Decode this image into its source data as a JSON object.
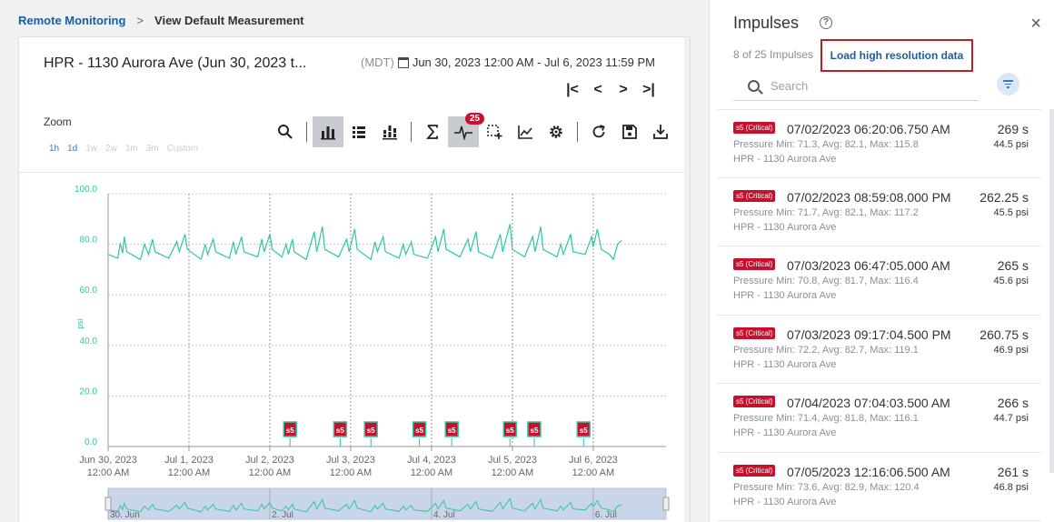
{
  "breadcrumb": {
    "root": "Remote Monitoring",
    "sep": ">",
    "current": "View Default Measurement"
  },
  "card": {
    "title": "HPR - 1130 Aurora Ave (Jun 30, 2023 t...",
    "tz": "(MDT)",
    "range": "Jun 30, 2023 12:00 AM - Jul 6, 2023 11:59 PM",
    "pager": [
      "|<",
      "<",
      ">",
      ">|"
    ]
  },
  "zoom": {
    "label": "Zoom",
    "options": [
      "1h",
      "1d",
      "1w",
      "2w",
      "1m",
      "3m",
      "Custom"
    ],
    "active": [
      "1h",
      "1d"
    ]
  },
  "toolbar": {
    "impulse_badge": "25"
  },
  "chart_data": {
    "type": "line",
    "ylabel": "psi",
    "ylim": [
      0,
      100
    ],
    "yticks": [
      "100.0",
      "80.0",
      "60.0",
      "40.0",
      "20.0",
      "0.0"
    ],
    "xticks": [
      [
        "Jun 30, 2023",
        "12:00 AM"
      ],
      [
        "Jul 1, 2023",
        "12:00 AM"
      ],
      [
        "Jul 2, 2023",
        "12:00 AM"
      ],
      [
        "Jul 3, 2023",
        "12:00 AM"
      ],
      [
        "Jul 4, 2023",
        "12:00 AM"
      ],
      [
        "Jul 5, 2023",
        "12:00 AM"
      ],
      [
        "Jul 6, 2023",
        "12:00 AM"
      ]
    ],
    "xlim_days": [
      0,
      6.9
    ],
    "series": [
      {
        "color": "#2ec7a0",
        "points": [
          [
            0.0,
            76.0
          ],
          [
            0.12,
            74.5
          ],
          [
            0.15,
            80.5
          ],
          [
            0.18,
            76.5
          ],
          [
            0.2,
            83.0
          ],
          [
            0.23,
            77.0
          ],
          [
            0.4,
            74.0
          ],
          [
            0.45,
            80.0
          ],
          [
            0.5,
            76.0
          ],
          [
            0.55,
            82.0
          ],
          [
            0.58,
            77.0
          ],
          [
            0.75,
            74.5
          ],
          [
            0.85,
            81.0
          ],
          [
            0.88,
            77.0
          ],
          [
            0.95,
            84.0
          ],
          [
            0.98,
            78.0
          ],
          [
            1.15,
            74.0
          ],
          [
            1.2,
            80.0
          ],
          [
            1.23,
            76.0
          ],
          [
            1.3,
            82.0
          ],
          [
            1.33,
            77.0
          ],
          [
            1.5,
            74.5
          ],
          [
            1.55,
            81.0
          ],
          [
            1.58,
            76.0
          ],
          [
            1.65,
            83.0
          ],
          [
            1.68,
            77.0
          ],
          [
            1.85,
            75.0
          ],
          [
            1.9,
            82.0
          ],
          [
            1.93,
            77.0
          ],
          [
            2.0,
            84.0
          ],
          [
            2.03,
            78.0
          ],
          [
            2.15,
            75.0
          ],
          [
            2.2,
            80.0
          ],
          [
            2.23,
            76.0
          ],
          [
            2.28,
            82.0
          ],
          [
            2.3,
            77.0
          ],
          [
            2.45,
            74.0
          ],
          [
            2.55,
            85.0
          ],
          [
            2.58,
            77.0
          ],
          [
            2.65,
            87.0
          ],
          [
            2.68,
            78.0
          ],
          [
            2.85,
            75.0
          ],
          [
            2.95,
            82.0
          ],
          [
            2.98,
            77.0
          ],
          [
            3.05,
            86.0
          ],
          [
            3.08,
            78.0
          ],
          [
            3.25,
            74.0
          ],
          [
            3.3,
            81.0
          ],
          [
            3.33,
            77.0
          ],
          [
            3.4,
            83.0
          ],
          [
            3.43,
            77.0
          ],
          [
            3.6,
            74.5
          ],
          [
            3.65,
            80.0
          ],
          [
            3.68,
            76.0
          ],
          [
            3.75,
            81.0
          ],
          [
            3.78,
            76.0
          ],
          [
            3.95,
            74.5
          ],
          [
            4.05,
            83.0
          ],
          [
            4.08,
            77.0
          ],
          [
            4.15,
            86.0
          ],
          [
            4.18,
            78.0
          ],
          [
            4.35,
            75.0
          ],
          [
            4.45,
            82.0
          ],
          [
            4.48,
            77.0
          ],
          [
            4.55,
            85.0
          ],
          [
            4.58,
            77.0
          ],
          [
            4.75,
            74.5
          ],
          [
            4.85,
            84.0
          ],
          [
            4.88,
            77.0
          ],
          [
            4.97,
            88.0
          ],
          [
            5.0,
            78.0
          ],
          [
            5.15,
            75.0
          ],
          [
            5.25,
            83.0
          ],
          [
            5.28,
            77.0
          ],
          [
            5.35,
            87.0
          ],
          [
            5.38,
            78.0
          ],
          [
            5.55,
            75.0
          ],
          [
            5.6,
            80.0
          ],
          [
            5.63,
            76.0
          ],
          [
            5.72,
            84.0
          ],
          [
            5.75,
            77.0
          ],
          [
            5.9,
            76.0
          ],
          [
            5.98,
            83.0
          ],
          [
            6.0,
            79.0
          ],
          [
            6.05,
            86.0
          ],
          [
            6.1,
            78.0
          ],
          [
            6.2,
            76.0
          ],
          [
            6.25,
            74.0
          ],
          [
            6.3,
            80.0
          ],
          [
            6.35,
            81.5
          ]
        ]
      }
    ],
    "markers": {
      "label": "s5",
      "x_days": [
        2.25,
        2.87,
        3.25,
        3.85,
        4.25,
        4.97,
        5.27,
        5.88
      ]
    },
    "navigator_labels": [
      "30. Jun",
      "2. Jul",
      "4. Jul",
      "6. Jul"
    ]
  },
  "panel": {
    "title": "Impulses",
    "help": "?",
    "close": "×",
    "count": "8 of 25 Impulses",
    "load_label": "Load high resolution data",
    "search_placeholder": "Search",
    "items": [
      {
        "tag": "s5 (Critical)",
        "ts": "07/02/2023 06:20:06.750 AM",
        "dur": "269 s",
        "stats": "Pressure Min: 71.3, Avg: 82.1, Max: 115.8",
        "psi": "44.5 psi",
        "loc": "HPR - 1130 Aurora Ave"
      },
      {
        "tag": "s5 (Critical)",
        "ts": "07/02/2023 08:59:08.000 PM",
        "dur": "262.25 s",
        "stats": "Pressure Min: 71.7, Avg: 82.1, Max: 117.2",
        "psi": "45.5 psi",
        "loc": "HPR - 1130 Aurora Ave"
      },
      {
        "tag": "s5 (Critical)",
        "ts": "07/03/2023 06:47:05.000 AM",
        "dur": "265 s",
        "stats": "Pressure Min: 70.8, Avg: 81.7, Max: 116.4",
        "psi": "45.6 psi",
        "loc": "HPR - 1130 Aurora Ave"
      },
      {
        "tag": "s5 (Critical)",
        "ts": "07/03/2023 09:17:04.500 PM",
        "dur": "260.75 s",
        "stats": "Pressure Min: 72.2, Avg: 82.7, Max: 119.1",
        "psi": "46.9 psi",
        "loc": "HPR - 1130 Aurora Ave"
      },
      {
        "tag": "s5 (Critical)",
        "ts": "07/04/2023 07:04:03.500 AM",
        "dur": "266 s",
        "stats": "Pressure Min: 71.4, Avg: 81.8, Max: 116.1",
        "psi": "44.7 psi",
        "loc": "HPR - 1130 Aurora Ave"
      },
      {
        "tag": "s5 (Critical)",
        "ts": "07/05/2023 12:16:06.500 AM",
        "dur": "261 s",
        "stats": "Pressure Min: 73.6, Avg: 82.9, Max: 120.4",
        "psi": "46.8 psi",
        "loc": "HPR - 1130 Aurora Ave"
      }
    ]
  }
}
